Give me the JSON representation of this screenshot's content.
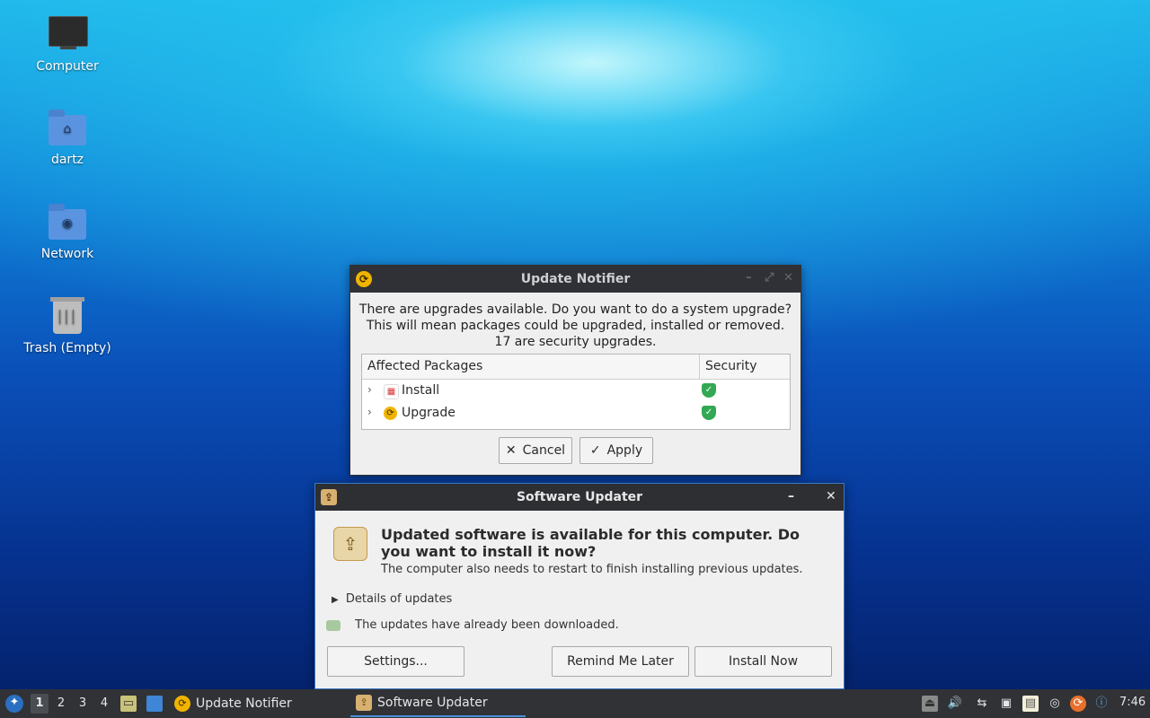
{
  "desktop": {
    "icons": [
      {
        "label": "Computer",
        "glyph": "monitor-icon"
      },
      {
        "label": "dartz",
        "glyph": "home-folder-icon"
      },
      {
        "label": "Network",
        "glyph": "network-folder-icon"
      },
      {
        "label": "Trash (Empty)",
        "glyph": "trash-icon"
      }
    ]
  },
  "notifier": {
    "title": "Update Notifier",
    "message": {
      "line1": "There are upgrades available. Do you want to do a system upgrade?",
      "line2": "This will mean packages could be upgraded, installed or removed.",
      "line3": "17 are security upgrades."
    },
    "columns": {
      "packages": "Affected Packages",
      "security": "Security"
    },
    "rows": [
      {
        "label": "Install",
        "icon": "install-icon",
        "secure": true
      },
      {
        "label": "Upgrade",
        "icon": "upgrade-icon",
        "secure": true
      }
    ],
    "buttons": {
      "cancel": "Cancel",
      "apply": "Apply"
    }
  },
  "updater": {
    "title": "Software Updater",
    "headline": "Updated software is available for this computer. Do you want to install it now?",
    "subline": "The computer also needs to restart to finish installing previous updates.",
    "details": "Details of updates",
    "downloaded": "The updates have already been downloaded.",
    "buttons": {
      "settings": "Settings...",
      "remind": "Remind Me Later",
      "install": "Install Now"
    }
  },
  "taskbar": {
    "workspaces": [
      "1",
      "2",
      "3",
      "4"
    ],
    "active_workspace": "1",
    "tasks": [
      {
        "label": "Update Notifier",
        "active": false
      },
      {
        "label": "Software Updater",
        "active": true
      }
    ],
    "clock": "7:46"
  },
  "colors": {
    "accent": "#4a90d9",
    "titlebar": "#2f3136",
    "shield": "#33a853"
  }
}
